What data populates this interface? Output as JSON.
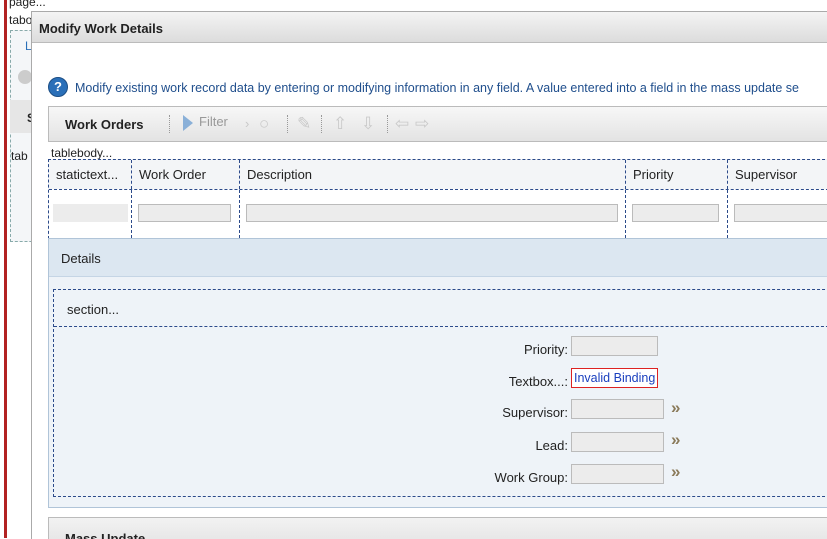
{
  "background": {
    "line1": "page...",
    "line2": "tabo",
    "line3": "L",
    "line4": "S",
    "line5": "tab"
  },
  "dialog": {
    "title": "Modify Work Details",
    "help_text": "Modify existing work record data by entering or modifying information in any field. A value entered into a field in the mass update se"
  },
  "toolbar": {
    "title": "Work Orders",
    "filter_label": "Filter"
  },
  "table": {
    "body_label": "tablebody...",
    "columns": [
      "statictext...",
      "Work Order",
      "Description",
      "Priority",
      "Supervisor"
    ]
  },
  "details": {
    "header": "Details",
    "section_label": "section...",
    "fields": {
      "priority_label": "Priority:",
      "textbox_label": "Textbox...:",
      "textbox_value": "Invalid Binding",
      "supervisor_label": "Supervisor:",
      "lead_label": "Lead:",
      "work_group_label": "Work Group:"
    }
  },
  "mass_update": {
    "header": "Mass Update"
  },
  "colors": {
    "accent": "#1f4e8c",
    "error_border": "#dd2222",
    "border_dashed": "#2b4a8a"
  }
}
